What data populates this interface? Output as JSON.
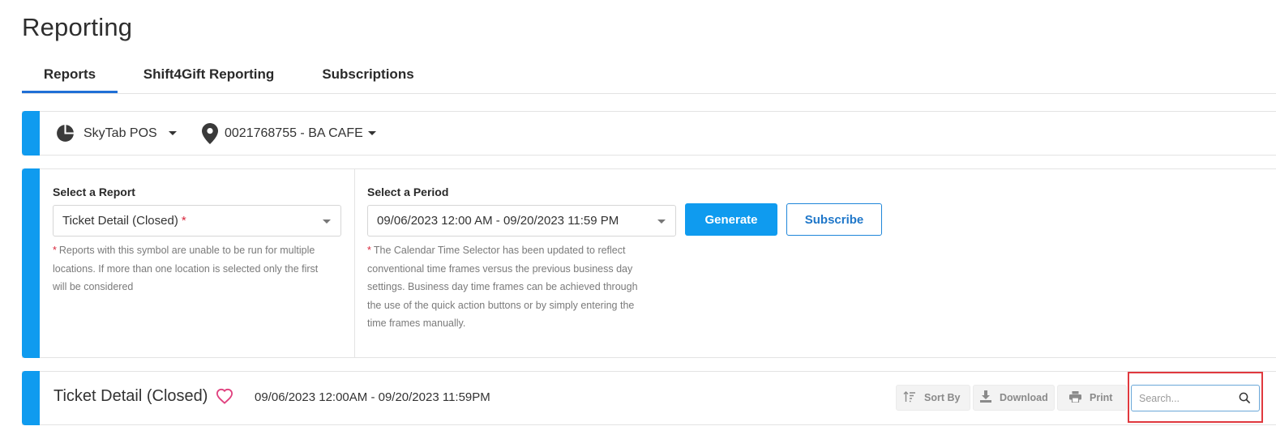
{
  "page": {
    "title": "Reporting"
  },
  "tabs": [
    {
      "label": "Reports",
      "active": true
    },
    {
      "label": "Shift4Gift Reporting",
      "active": false
    },
    {
      "label": "Subscriptions",
      "active": false
    }
  ],
  "pos_bar": {
    "product": {
      "label": "SkyTab POS",
      "icon": "pie-chart-icon"
    },
    "location": {
      "label": "0021768755 - BA CAFE",
      "icon": "map-pin-icon"
    }
  },
  "report_select": {
    "label": "Select a Report",
    "value": "Ticket Detail (Closed)",
    "required_mark": "*",
    "note_mark": "*",
    "note_lines": [
      "Reports with this symbol are unable to be run for multiple",
      "locations. If more than one location is selected only the first",
      "will be considered"
    ]
  },
  "period_select": {
    "label": "Select a Period",
    "value": "09/06/2023 12:00 AM - 09/20/2023 11:59 PM",
    "note_mark": "*",
    "note_lines": [
      "The Calendar Time Selector has been updated to reflect",
      "conventional time frames versus the previous business day",
      "settings. Business day time frames can be achieved through",
      "the use of the quick action buttons or by simply entering the",
      "time frames manually."
    ]
  },
  "actions": {
    "generate_label": "Generate",
    "subscribe_label": "Subscribe"
  },
  "report_header": {
    "title": "Ticket Detail (Closed)",
    "range": "09/06/2023 12:00AM - 09/20/2023 11:59PM",
    "sort_label": "Sort By",
    "download_label": "Download",
    "print_label": "Print",
    "search_placeholder": "Search..."
  },
  "colors": {
    "accent": "#0f9bef",
    "tab_underline": "#1f6fd6",
    "required": "#d8283d",
    "heart": "#e0407e",
    "highlight": "#e0393e"
  }
}
